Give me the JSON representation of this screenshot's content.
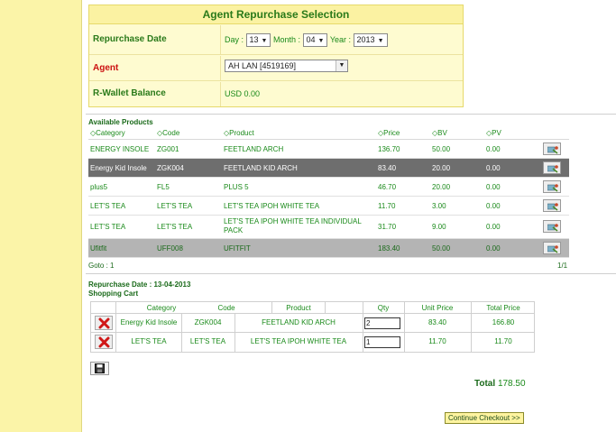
{
  "selection": {
    "title": "Agent Repurchase Selection",
    "date_label": "Repurchase Date",
    "day_label": "Day :",
    "day_value": "13",
    "month_label": "Month :",
    "month_value": "04",
    "year_label": "Year :",
    "year_value": "2013",
    "agent_label": "Agent",
    "agent_value": "AH LAN [4519169]",
    "wallet_label": "R-Wallet Balance",
    "wallet_value": "USD 0.00"
  },
  "products": {
    "title": "Available Products",
    "headers": [
      "Category",
      "Code",
      "Product",
      "Price",
      "BV",
      "PV"
    ],
    "sort_icon": "sort-icon",
    "add_icon": "add-to-cart-icon",
    "rows": [
      {
        "category": "ENERGY INSOLE",
        "code": "ZG001",
        "product": "FEETLAND ARCH",
        "price": "136.70",
        "bv": "50.00",
        "pv": "0.00"
      },
      {
        "category": "Energy Kid Insole",
        "code": "ZGK004",
        "product": "FEETLAND KID ARCH",
        "price": "83.40",
        "bv": "20.00",
        "pv": "0.00"
      },
      {
        "category": "plus5",
        "code": "FL5",
        "product": "PLUS 5",
        "price": "46.70",
        "bv": "20.00",
        "pv": "0.00"
      },
      {
        "category": "LET'S TEA",
        "code": "LET'S TEA",
        "product": "LET'S TEA IPOH WHITE TEA",
        "price": "11.70",
        "bv": "3.00",
        "pv": "0.00"
      },
      {
        "category": "LET'S TEA",
        "code": "LET'S TEA",
        "product": "LET'S TEA IPOH WHITE TEA INDIVIDUAL PACK",
        "price": "31.70",
        "bv": "9.00",
        "pv": "0.00"
      },
      {
        "category": "Ufitfit",
        "code": "UFF008",
        "product": "UFITFIT",
        "price": "183.40",
        "bv": "50.00",
        "pv": "0.00"
      }
    ],
    "goto": "Goto : 1",
    "pager": "1/1"
  },
  "cart": {
    "date_line": "Repurchase Date : 13-04-2013",
    "title": "Shopping Cart",
    "headers": [
      "Category",
      "Code",
      "Product",
      "Qty",
      "Unit Price",
      "Total Price"
    ],
    "delete_icon": "delete-x-icon",
    "rows": [
      {
        "category": "Energy Kid Insole",
        "code": "ZGK004",
        "product": "FEETLAND KID ARCH",
        "qty": "2",
        "unit_price": "83.40",
        "total_price": "166.80"
      },
      {
        "category": "LET'S TEA",
        "code": "LET'S TEA",
        "product": "LET'S TEA IPOH WHITE TEA",
        "qty": "1",
        "unit_price": "11.70",
        "total_price": "11.70"
      }
    ],
    "save_icon": "floppy-disk-icon",
    "total_label": "Total",
    "total_value": "178.50",
    "checkout_label": "Continue Checkout >>"
  },
  "colors": {
    "left_strip": "#fbf4a8",
    "panel_bg": "#fefbd0",
    "text_green": "#1a8a1a",
    "agent_red": "#cc1111",
    "selected_row": "#6e6e6e",
    "grey_row": "#b4b4b4"
  }
}
